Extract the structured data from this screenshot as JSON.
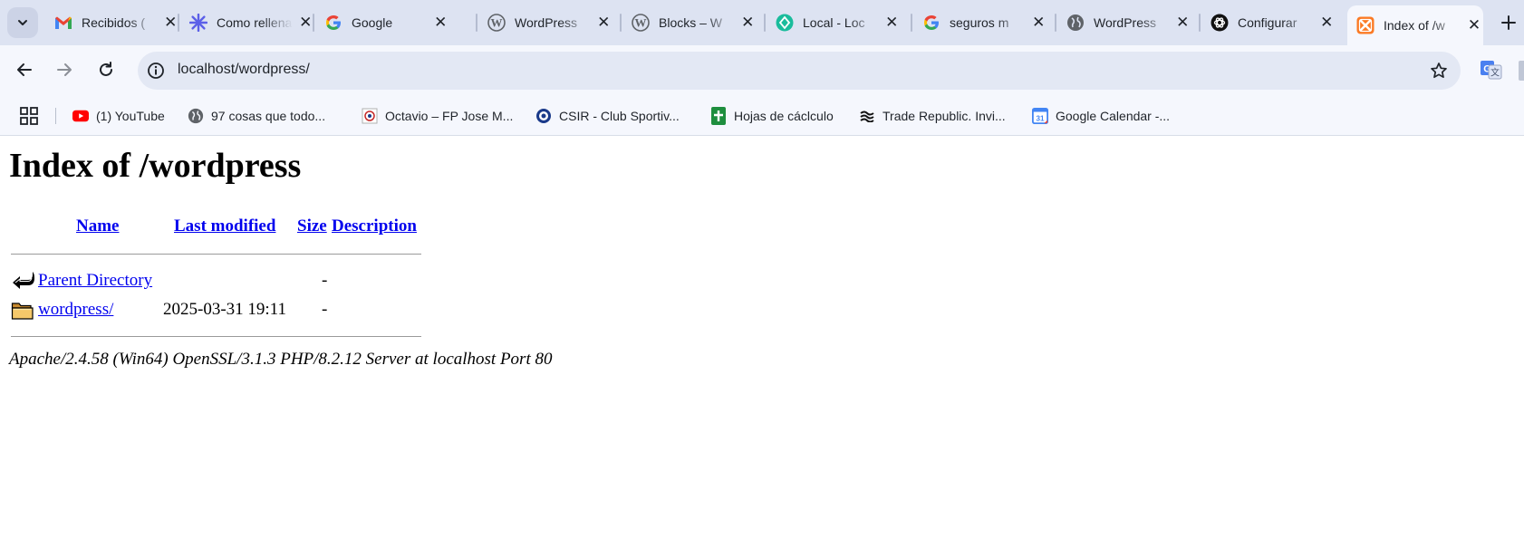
{
  "tabs": [
    {
      "title": "Recibidos (",
      "icon": "gmail-icon"
    },
    {
      "title": "Como rellenar",
      "icon": "sparkle-icon"
    },
    {
      "title": "Google",
      "icon": "google-icon"
    },
    {
      "title": "WordPress",
      "icon": "wordpress-icon"
    },
    {
      "title": "Blocks – W",
      "icon": "wordpress-icon"
    },
    {
      "title": "Local - Loc",
      "icon": "local-icon"
    },
    {
      "title": "seguros m",
      "icon": "google-icon"
    },
    {
      "title": "WordPress",
      "icon": "globe-icon"
    },
    {
      "title": "Configurar",
      "icon": "openai-icon"
    },
    {
      "title": "Index of /w",
      "icon": "xampp-icon",
      "active": true
    }
  ],
  "address_bar": {
    "url": "localhost/wordpress/"
  },
  "bookmarks": [
    {
      "label": "(1) YouTube",
      "icon": "youtube-icon"
    },
    {
      "label": "97 cosas que todo...",
      "icon": "globe-icon"
    },
    {
      "label": "Octavio – FP Jose M...",
      "icon": "school-icon"
    },
    {
      "label": "CSIR - Club Sportiv...",
      "icon": "club-icon"
    },
    {
      "label": "Hojas de cáclculo",
      "icon": "sheets-icon"
    },
    {
      "label": "Trade Republic. Invi...",
      "icon": "trade-republic-icon"
    },
    {
      "label": "Google Calendar -...",
      "icon": "calendar-icon"
    }
  ],
  "page": {
    "heading": "Index of /wordpress",
    "columns": {
      "name": "Name",
      "last_modified": "Last modified",
      "size": "Size",
      "description": "Description"
    },
    "rows": [
      {
        "name": "Parent Directory",
        "last_modified": "",
        "size": "-",
        "icon": "back-arrow-icon"
      },
      {
        "name": "wordpress/",
        "last_modified": "2025-03-31 19:11",
        "size": "-",
        "icon": "folder-icon"
      }
    ],
    "address": "Apache/2.4.58 (Win64) OpenSSL/3.1.3 PHP/8.2.12 Server at localhost Port 80"
  },
  "calendar_icon_text": "31",
  "colors": {
    "tab_strip": "#dde3f2",
    "toolbar": "#f5f7fd",
    "link": "#0000ee"
  }
}
